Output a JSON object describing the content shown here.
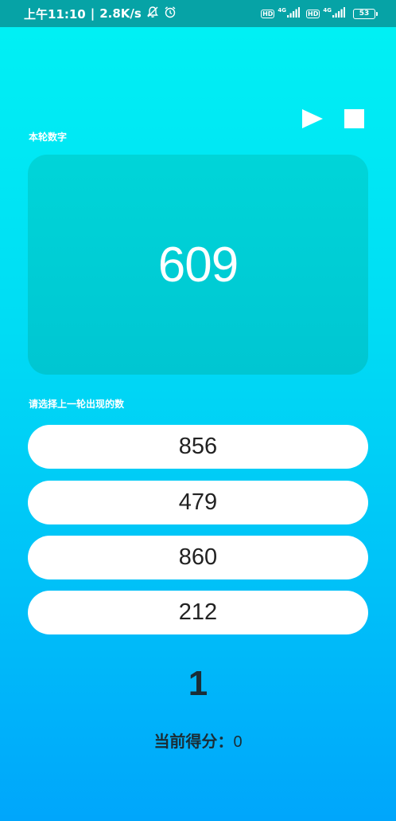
{
  "status_bar": {
    "time": "上午11:10",
    "separator": "|",
    "speed": "2.8K/s",
    "hd1": "HD",
    "net1": "4G",
    "hd2": "HD",
    "net2": "4G",
    "battery": "53",
    "icons": [
      "mute-bell-icon",
      "alarm-icon",
      "signal-icon",
      "battery-icon"
    ]
  },
  "controls": {
    "icons": [
      "play-icon",
      "stop-icon"
    ]
  },
  "current_round": {
    "label": "本轮数字",
    "number": "609"
  },
  "question": {
    "label": "请选择上一轮出现的数",
    "options": [
      "856",
      "479",
      "860",
      "212"
    ]
  },
  "round_counter": "1",
  "score": {
    "label": "当前得分：",
    "value": "0"
  },
  "colors": {
    "status_bar": "#06a3a6",
    "background_top": "#00f2f4",
    "background_bottom": "#00a6fb",
    "card": "#00ccd6",
    "option_bg": "#ffffff",
    "dark_text": "#1a2d36"
  }
}
